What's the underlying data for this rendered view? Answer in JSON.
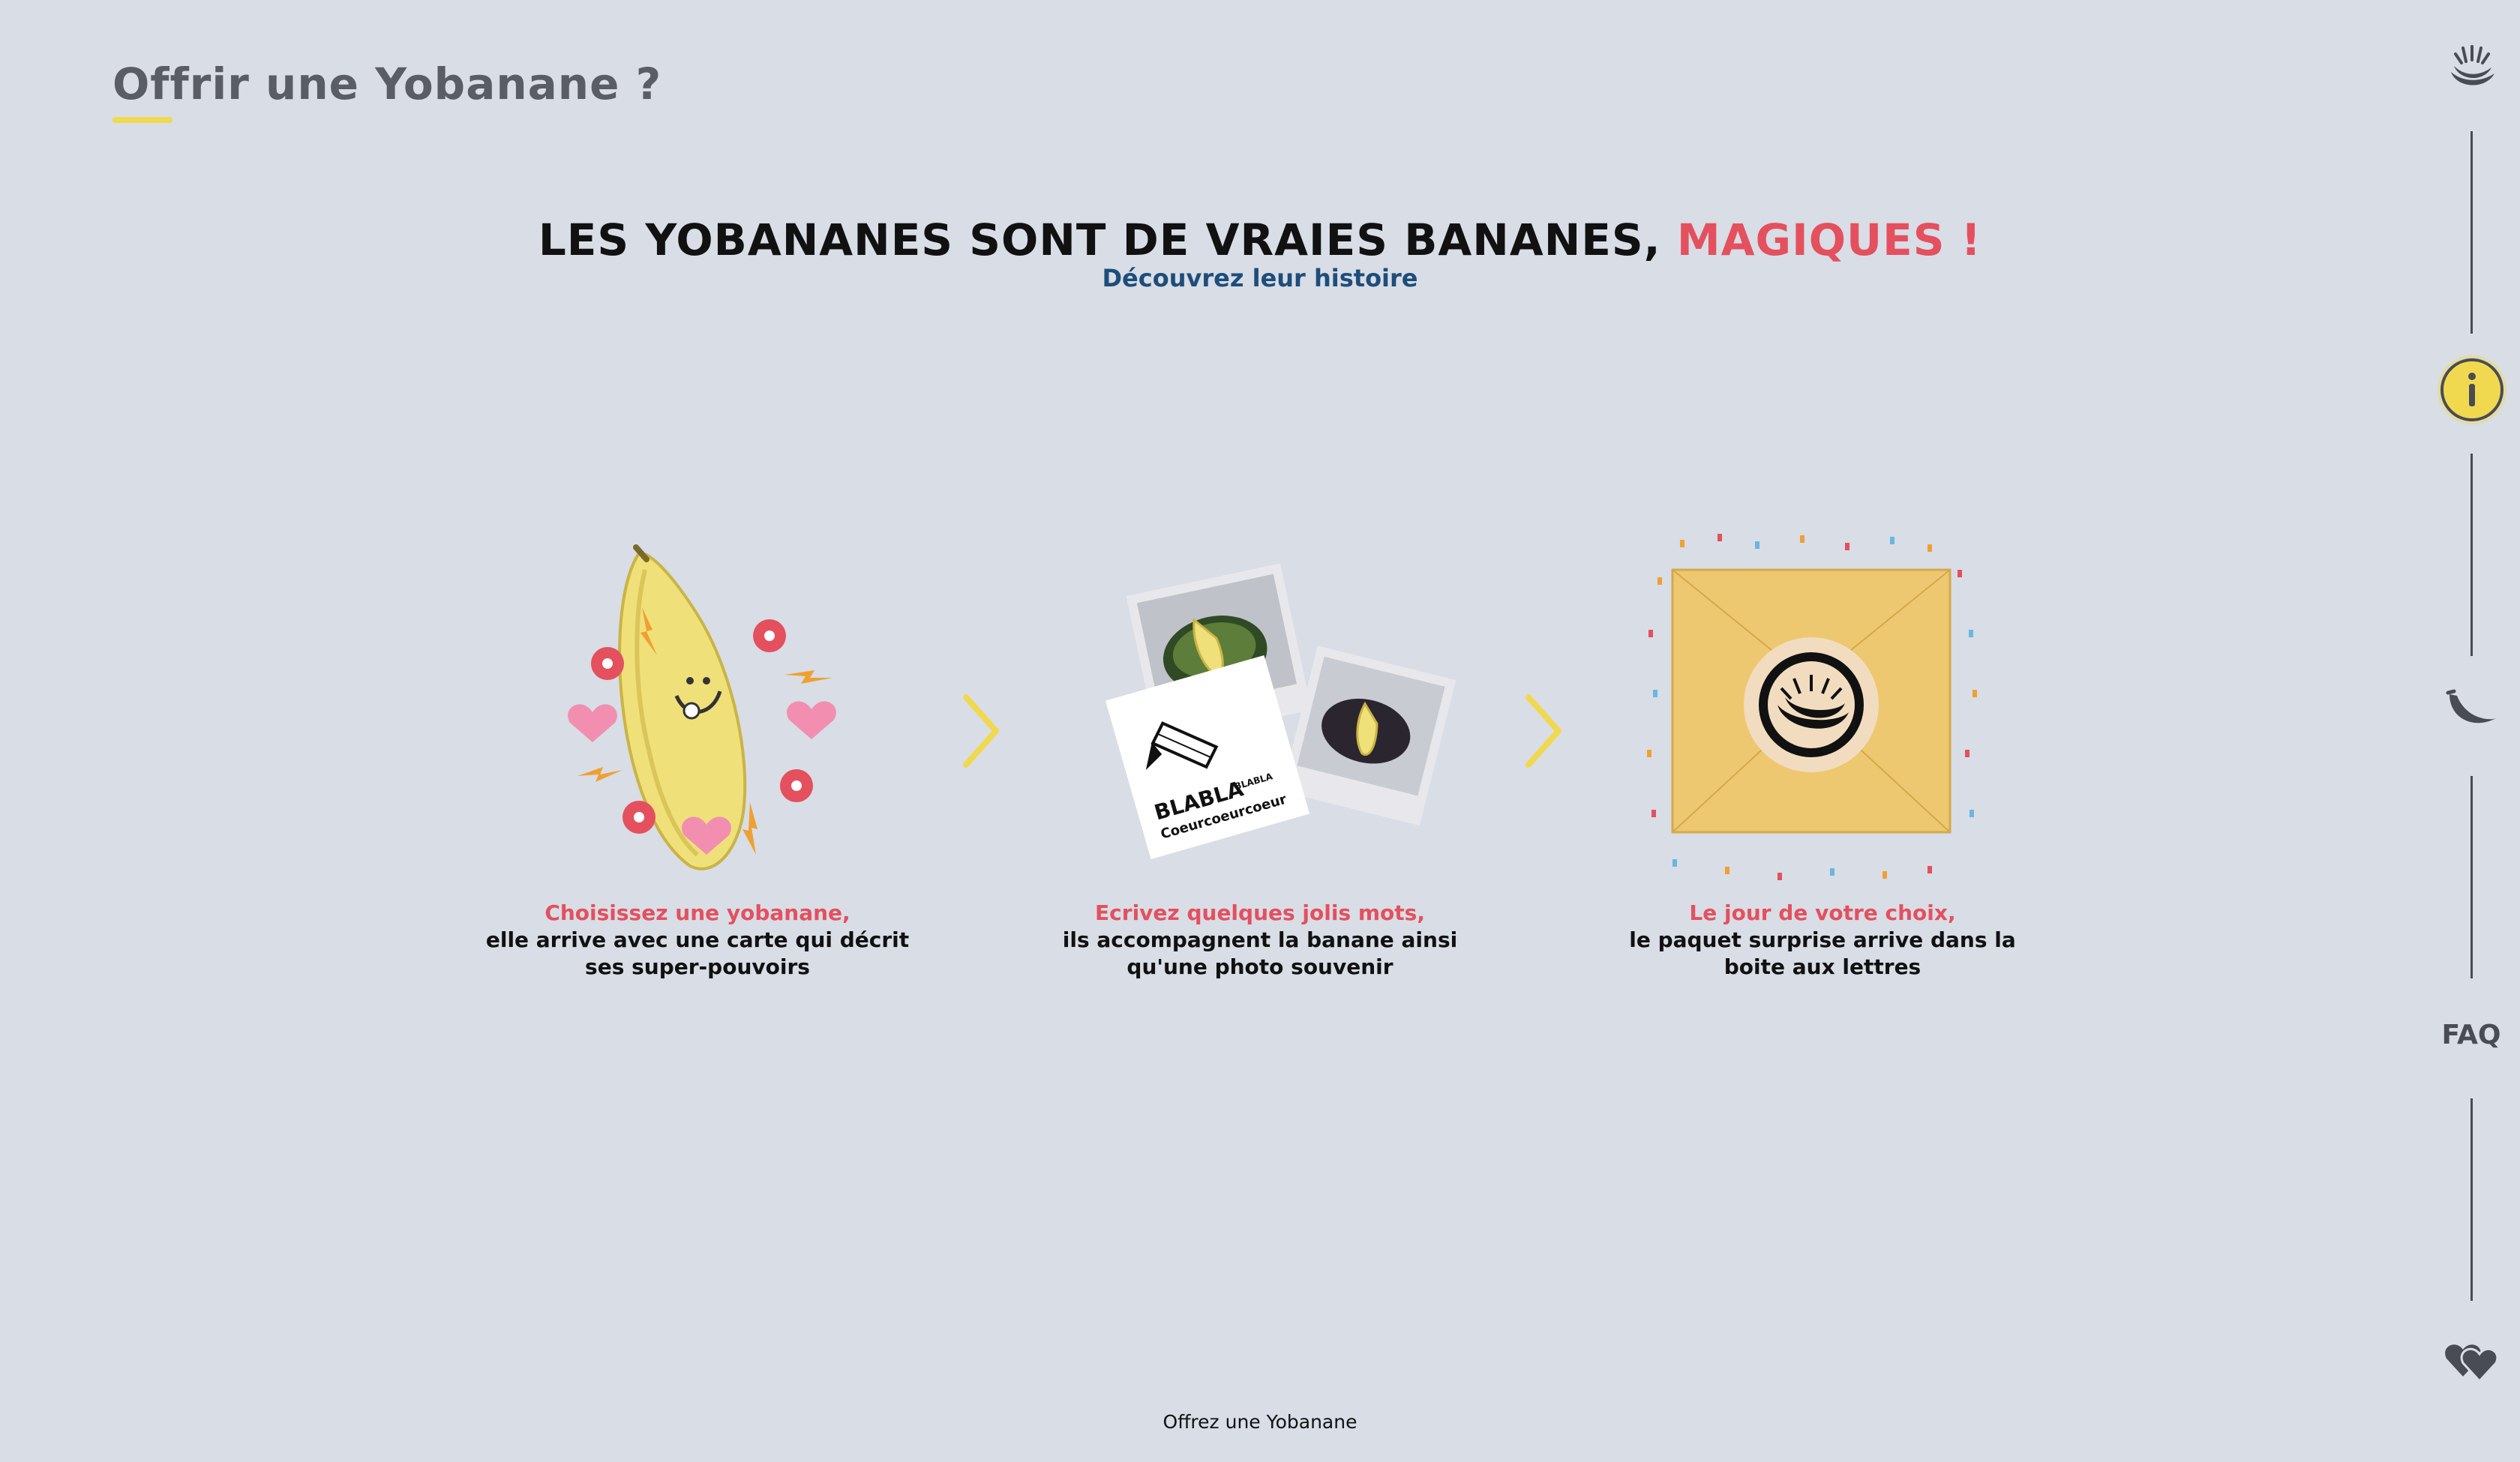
{
  "header": {
    "title": "Offrir une Yobanane ?"
  },
  "hero": {
    "headline_main": "LES YOBANANES SONT DE VRAIES BANANES,",
    "headline_accent": "MAGIQUES !",
    "subline": "Découvrez leur histoire"
  },
  "steps": [
    {
      "highlight": "Choisissez une yobanane,",
      "line1": "elle arrive avec une carte qui décrit",
      "line2": "ses super-pouvoirs"
    },
    {
      "highlight": "Ecrivez quelques jolis mots,",
      "line1": "ils accompagnent la banane ainsi",
      "line2": "qu'une photo souvenir",
      "card_text_1": "BLABLA",
      "card_text_1_small": "BLABLA",
      "card_text_2": "Coeurcoeurcoeur"
    },
    {
      "highlight": "Le jour de votre choix,",
      "line1": "le paquet surprise arrive dans la",
      "line2": "boite aux lettres"
    }
  ],
  "sidebar": {
    "items": [
      {
        "icon": "banana-bunch-icon"
      },
      {
        "icon": "info-icon",
        "active": true
      },
      {
        "icon": "banana-icon"
      },
      {
        "label": "FAQ"
      },
      {
        "icon": "hearts-icon"
      }
    ]
  },
  "footer": {
    "link": "Offrez une Yobanane"
  },
  "colors": {
    "background": "#d8dde6",
    "accent_red": "#e4505e",
    "accent_yellow": "#f1d94f",
    "link_blue": "#1e4d7a"
  }
}
